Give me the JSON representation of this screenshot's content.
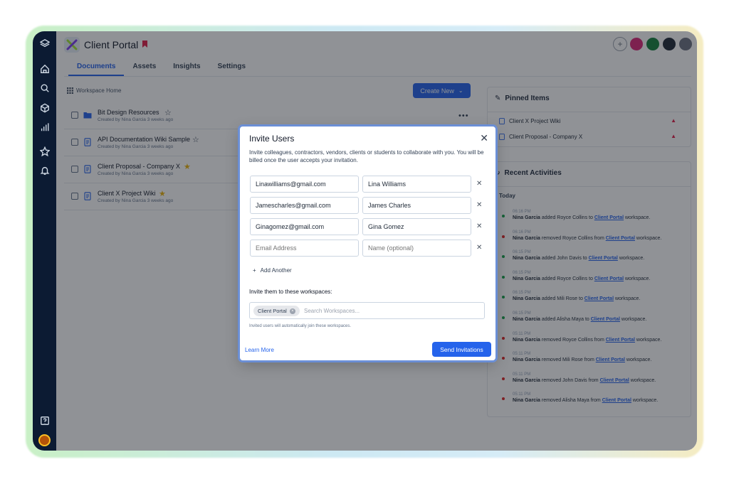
{
  "app": {
    "title": "Client Portal",
    "accent": "#2563eb"
  },
  "rail": {
    "icons": [
      "layers-logo-icon",
      "home-icon",
      "search-icon",
      "cube-icon",
      "bar-chart-icon",
      "star-icon",
      "bell-icon",
      "help-icon",
      "user-avatar"
    ]
  },
  "tabs": [
    {
      "label": "Documents",
      "active": true
    },
    {
      "label": "Assets",
      "active": false
    },
    {
      "label": "Insights",
      "active": false
    },
    {
      "label": "Settings",
      "active": false
    }
  ],
  "breadcrumb": "Workspace Home",
  "create_button": "Create New",
  "documents": [
    {
      "name": "Bit Design Resources",
      "sub": "Created by Nina Garcia 3 weeks ago",
      "type": "folder",
      "starred": false
    },
    {
      "name": "API Documentation Wiki Sample",
      "sub": "Created by Nina Garcia 3 weeks ago",
      "type": "doc",
      "starred": false
    },
    {
      "name": "Client Proposal - Company X",
      "sub": "Created by Nina Garcia 3 weeks ago",
      "type": "doc",
      "starred": true
    },
    {
      "name": "Client X Project Wiki",
      "sub": "Created by Nina Garcia 3 weeks ago",
      "type": "doc",
      "starred": true
    }
  ],
  "pinned": {
    "title": "Pinned Items",
    "items": [
      "Client X Project Wiki",
      "Client Proposal - Company X"
    ]
  },
  "activities": {
    "title": "Recent Activities",
    "day": "Today",
    "items": [
      {
        "time": "06:16 PM",
        "user": "Nina Garcia",
        "text": " added Royce Collins to ",
        "link": "Client Portal",
        "end": " workspace.",
        "color": "#16a34a"
      },
      {
        "time": "06:16 PM",
        "user": "Nina Garcia",
        "text": " removed Royce Collins from ",
        "link": "Client Portal",
        "end": " workspace.",
        "color": "#dc2626"
      },
      {
        "time": "06:15 PM",
        "user": "Nina Garcia",
        "text": " added John Davis to ",
        "link": "Client Portal",
        "end": " workspace.",
        "color": "#16a34a"
      },
      {
        "time": "06:15 PM",
        "user": "Nina Garcia",
        "text": " added Royce Collins to ",
        "link": "Client Portal",
        "end": " workspace.",
        "color": "#16a34a"
      },
      {
        "time": "06:15 PM",
        "user": "Nina Garcia",
        "text": " added Mili Rose to ",
        "link": "Client Portal",
        "end": " workspace.",
        "color": "#16a34a"
      },
      {
        "time": "06:15 PM",
        "user": "Nina Garcia",
        "text": " added Alisha Maya to ",
        "link": "Client Portal",
        "end": " workspace.",
        "color": "#16a34a"
      },
      {
        "time": "05:11 PM",
        "user": "Nina Garcia",
        "text": " removed Royce Collins from ",
        "link": "Client Portal",
        "end": " workspace.",
        "color": "#dc2626"
      },
      {
        "time": "05:11 PM",
        "user": "Nina Garcia",
        "text": " removed Mili Rose from ",
        "link": "Client Portal",
        "end": " workspace.",
        "color": "#dc2626"
      },
      {
        "time": "05:11 PM",
        "user": "Nina Garcia",
        "text": " removed John Davis from ",
        "link": "Client Portal",
        "end": " workspace.",
        "color": "#dc2626"
      },
      {
        "time": "05:11 PM",
        "user": "Nina Garcia",
        "text": " removed Alisha Maya from ",
        "link": "Client Portal",
        "end": " workspace.",
        "color": "#dc2626"
      }
    ]
  },
  "modal": {
    "title": "Invite Users",
    "description": "Invite colleagues, contractors, vendors, clients or students to collaborate with you. You will be billed once the user accepts your invitation.",
    "invites": [
      {
        "email": "Linawilliams@gmail.com",
        "name": "Lina Williams"
      },
      {
        "email": "Jamescharles@gmail.com",
        "name": "James Charles"
      },
      {
        "email": "Ginagomez@gmail.com",
        "name": "Gina Gomez"
      }
    ],
    "email_placeholder": "Email Address",
    "name_placeholder": "Name (optional)",
    "add_another": "Add Another",
    "workspaces_label": "Invite them to these workspaces:",
    "workspace_chip": "Client Portal",
    "workspace_search_placeholder": "Search Workspaces...",
    "workspace_note": "Invited users will automatically join these workspaces.",
    "learn_more": "Learn More",
    "send_button": "Send Invitations"
  }
}
